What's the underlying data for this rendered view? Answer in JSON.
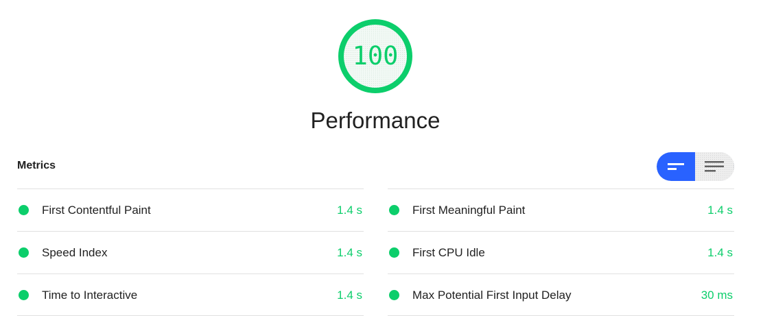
{
  "gauge": {
    "score": "100",
    "score_fraction": 1.0,
    "color": "#0cce6b"
  },
  "category": {
    "title": "Performance"
  },
  "metrics": {
    "header": "Metrics",
    "toggle": {
      "active_icon": "compact-lines-icon",
      "inactive_icon": "expanded-lines-icon",
      "active_color": "#2962ff"
    },
    "left": [
      {
        "title": "First Contentful Paint",
        "value": "1.4 s",
        "status": "pass"
      },
      {
        "title": "Speed Index",
        "value": "1.4 s",
        "status": "pass"
      },
      {
        "title": "Time to Interactive",
        "value": "1.4 s",
        "status": "pass"
      }
    ],
    "right": [
      {
        "title": "First Meaningful Paint",
        "value": "1.4 s",
        "status": "pass"
      },
      {
        "title": "First CPU Idle",
        "value": "1.4 s",
        "status": "pass"
      },
      {
        "title": "Max Potential First Input Delay",
        "value": "30 ms",
        "status": "pass"
      }
    ],
    "pass_color": "#0cce6b"
  }
}
